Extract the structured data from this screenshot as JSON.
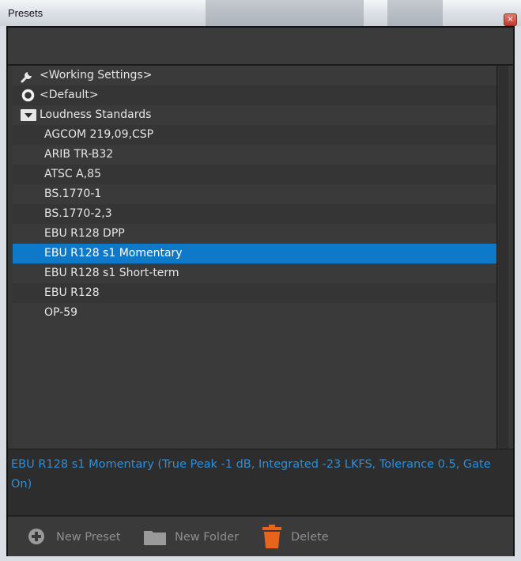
{
  "window": {
    "title": "Presets",
    "close_glyph": "×"
  },
  "list": {
    "items": [
      {
        "label": "<Working Settings>",
        "icon": "wrench-icon"
      },
      {
        "label": "<Default>",
        "icon": "circle-icon"
      },
      {
        "label": "Loudness Standards",
        "icon": "folder-expanded-icon"
      },
      {
        "label": "AGCOM 219,09,CSP"
      },
      {
        "label": "ARIB TR-B32"
      },
      {
        "label": "ATSC A,85"
      },
      {
        "label": "BS.1770-1"
      },
      {
        "label": "BS.1770-2,3"
      },
      {
        "label": "EBU R128 DPP"
      },
      {
        "label": "EBU R128 s1 Momentary",
        "selected": true
      },
      {
        "label": "EBU R128 s1 Short-term"
      },
      {
        "label": "EBU R128"
      },
      {
        "label": "OP-59"
      }
    ]
  },
  "info": {
    "description": "EBU R128 s1 Momentary (True Peak -1 dB, Integrated -23 LKFS, Tolerance 0.5, Gate On)"
  },
  "toolbar": {
    "new_preset_label": "New Preset",
    "new_folder_label": "New Folder",
    "delete_label": "Delete"
  },
  "colors": {
    "selection": "#0f79c9",
    "info_text": "#2e8fd6",
    "delete_icon": "#e8641c",
    "panel_bg": "#383838"
  }
}
